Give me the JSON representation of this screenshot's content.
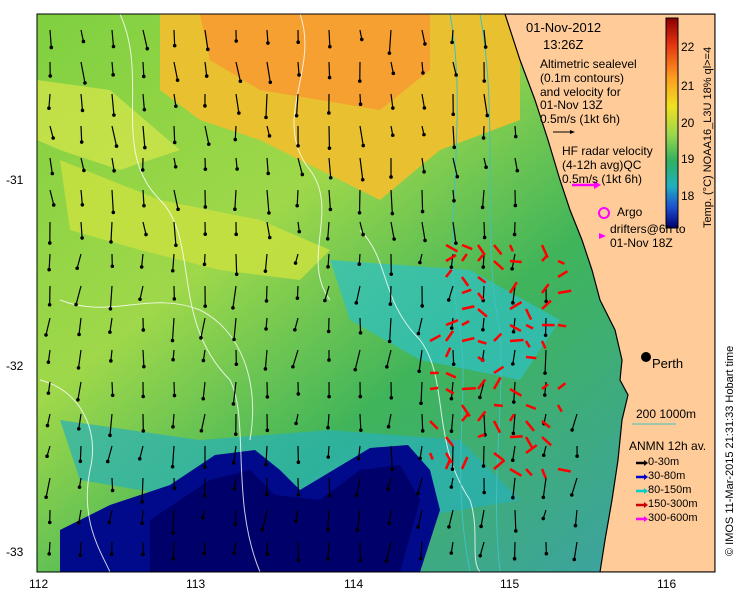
{
  "map": {
    "date": "01-Nov-2012",
    "time": "13:26Z",
    "altimetry_text": [
      "Altimetric sealevel",
      "(0.1m contours)",
      "and velocity for",
      "01-Nov 13Z"
    ],
    "altimetry_scale": "0.5m/s (1kt 6h)",
    "hf_text": [
      "HF radar velocity",
      "(4-12h avg)QC"
    ],
    "hf_scale": "0.5m/s (1kt 6h)",
    "argo_label": "Argo",
    "drifters_text": [
      "drifters@6h to",
      "01-Nov 18Z"
    ],
    "city": "Perth",
    "depth_contours": "200  1000m",
    "anmn_title": "ANMN 12h av.",
    "anmn_legend": [
      {
        "label": "0-30m",
        "color": "#000000"
      },
      {
        "label": "30-80m",
        "color": "#0000cc"
      },
      {
        "label": "80-150m",
        "color": "#00cccc"
      },
      {
        "label": "150-300m",
        "color": "#cc0000"
      },
      {
        "label": "300-600m",
        "color": "#ff00ff"
      }
    ],
    "credit": "© IMOS 11-Mar-2015 21:31:33 Hobart time",
    "colorbar": {
      "title": "Temp. (°C) NOAA16_L3U 18% ql>=4",
      "ticks": [
        "22",
        "21",
        "20",
        "19",
        "18"
      ]
    },
    "lon_ticks": [
      "112",
      "113",
      "114",
      "115",
      "116"
    ],
    "lat_ticks": [
      "-31",
      "-32",
      "-33"
    ],
    "colors": {
      "land": "#ffcc99",
      "coast": "#000000",
      "hf_arrow": "#ff0000",
      "argo": "#ff00ff"
    }
  }
}
